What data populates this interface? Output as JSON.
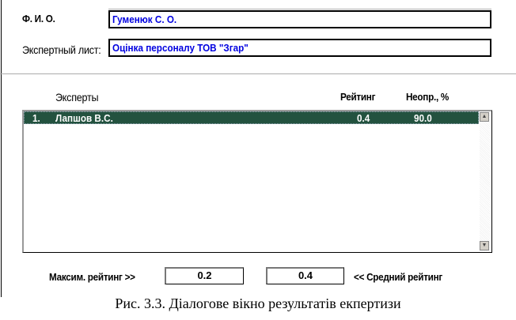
{
  "form": {
    "fio_label": "Ф. И. О.",
    "fio_value": "Гуменюк С. О.",
    "sheet_label": "Экспертный лист:",
    "sheet_value": "Оцінка персоналу ТОВ \"Згар\""
  },
  "list": {
    "headers": {
      "experts": "Эксперты",
      "rating": "Рейтинг",
      "uncertainty": "Неопр., %"
    },
    "rows": [
      {
        "num": "1.",
        "name": "Лапшов В.С.",
        "rating": "0.4",
        "uncertainty": "90.0"
      }
    ],
    "selected_color": "#23523f"
  },
  "summary": {
    "max_label": "Максим. рейтинг >>",
    "max_value": "0.2",
    "avg_value": "0.4",
    "avg_label": "<< Средний рейтинг"
  },
  "caption": "Рис. 3.3. Діалогове вікно результатів екпертизи"
}
